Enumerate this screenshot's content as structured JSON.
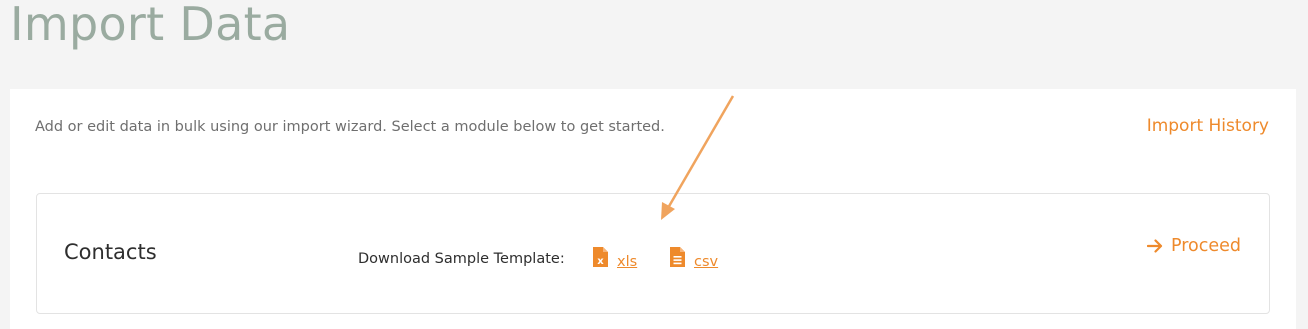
{
  "page": {
    "title": "Import Data"
  },
  "panel": {
    "intro_text": "Add or edit data in bulk using our import wizard. Select a module below to get started.",
    "history_link": "Import History"
  },
  "module": {
    "name": "Contacts",
    "download_label": "Download Sample Template:",
    "xls_label": "xls",
    "csv_label": "csv",
    "proceed_label": "Proceed"
  },
  "colors": {
    "accent": "#ee8a2c",
    "title": "#9aaba0",
    "background": "#f4f4f4"
  },
  "icons": {
    "xls": "excel-file-icon",
    "csv": "text-file-icon",
    "proceed": "arrow-right-icon"
  }
}
